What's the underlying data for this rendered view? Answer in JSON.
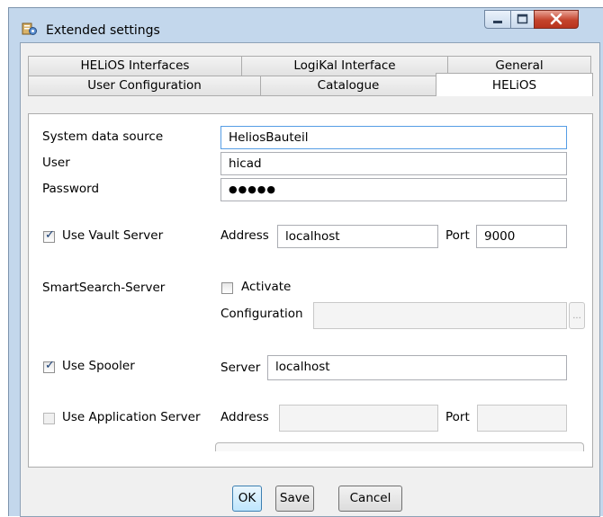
{
  "window": {
    "title": "Extended settings",
    "icons": {
      "app": "settings-app-icon",
      "minimize": "minimize-icon",
      "maximize": "maximize-icon",
      "close": "close-icon"
    }
  },
  "tabs": {
    "row1": [
      "HELiOS Interfaces",
      "LogiKal Interface",
      "General"
    ],
    "row2": [
      "User Configuration",
      "Catalogue",
      "HELiOS"
    ],
    "active": "HELiOS"
  },
  "form": {
    "system_data_source": {
      "label": "System data source",
      "value": "HeliosBauteil"
    },
    "user": {
      "label": "User",
      "value": "hicad"
    },
    "password": {
      "label": "Password",
      "value": "●●●●●"
    },
    "vault": {
      "label": "Use Vault Server",
      "checked": true,
      "address_label": "Address",
      "address": "localhost",
      "port_label": "Port",
      "port": "9000"
    },
    "smartsearch": {
      "label": "SmartSearch-Server",
      "activate_label": "Activate",
      "activate_checked": false,
      "config_label": "Configuration",
      "config_value": "",
      "browse": "..."
    },
    "spooler": {
      "label": "Use Spooler",
      "checked": true,
      "server_label": "Server",
      "server": "localhost"
    },
    "appserver": {
      "label": "Use Application Server",
      "checked": false,
      "address_label": "Address",
      "address": "",
      "port_label": "Port",
      "port": ""
    }
  },
  "buttons": {
    "ok": "OK",
    "save": "Save",
    "cancel": "Cancel"
  },
  "checkmark": "✓"
}
